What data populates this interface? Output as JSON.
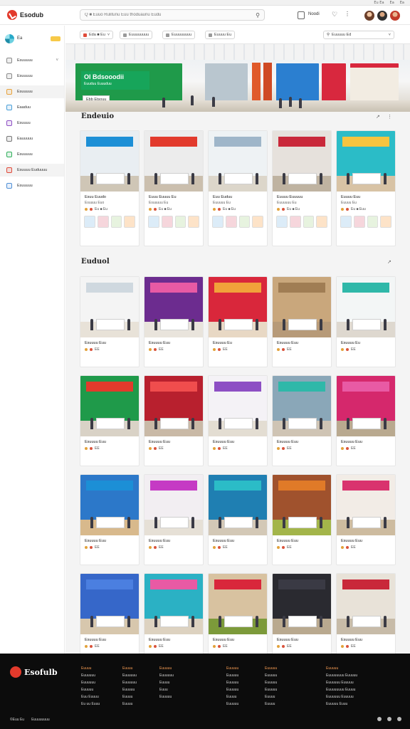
{
  "topbar": {
    "items": [
      "Eu Ea",
      "Ea",
      "Ea"
    ]
  },
  "header": {
    "brand": "Esodub",
    "search_placeholder": "Q ■ Euuo Rulitunu Euu thoduaunu Eudu",
    "notifications_label": "Noodi"
  },
  "sidebar": {
    "top_label": "Ea",
    "items": [
      {
        "label": "Esuuuuu",
        "icon": "home-icon",
        "color": "#8a8a8a",
        "has_chevron": true
      },
      {
        "label": "Esuuuuu",
        "icon": "store-icon",
        "color": "#8a8a8a"
      },
      {
        "label": "Esuuuuu",
        "icon": "grid-icon",
        "color": "#e8a23c",
        "active": true
      },
      {
        "label": "Eaaduu",
        "icon": "calendar-icon",
        "color": "#4a9fd8"
      },
      {
        "label": "Esuuuu",
        "icon": "tag-icon",
        "color": "#8d4fc4"
      },
      {
        "label": "Eauuuuu",
        "icon": "chart-icon",
        "color": "#777777"
      },
      {
        "label": "Esuuuuu",
        "icon": "leaf-icon",
        "color": "#2fae5a"
      },
      {
        "label": "Esuuuu Euduuuu",
        "icon": "alert-icon",
        "color": "#e04b3a",
        "active": true
      },
      {
        "label": "Esuuuuu",
        "icon": "settings-icon",
        "color": "#4f8fd6"
      }
    ]
  },
  "filters": [
    {
      "label": "Eda ■ Eu",
      "color": "#e04b3a"
    },
    {
      "label": "Euuuuuuuu",
      "color": "#999999"
    },
    {
      "label": "Euuuuuuuu",
      "color": "#999999"
    },
    {
      "label": "Euuuu Eu",
      "color": "#999999"
    }
  ],
  "filter_right": "Euuuuu Ed",
  "hero": {
    "sign_title": "Ol Bdsooodii",
    "sign_sub": "Euuduu Euuuduu",
    "tag": "Ebb Etsouu"
  },
  "featured": {
    "title": "Endeuio",
    "cards": [
      {
        "title": "Esuu Euudo",
        "sub": "Esuuuu Euo",
        "meta": "Eu ■ Eu",
        "wall": "#e9eef2",
        "sign": "#1c8fd6",
        "floor": "#cfc6b6"
      },
      {
        "title": "Euuu Euuuu Eu",
        "sub": "Esuuuuu Eu",
        "meta": "Eu ■ Eu",
        "wall": "#ececec",
        "sign": "#e23a2c",
        "floor": "#cbbfae"
      },
      {
        "title": "Euu Euduu",
        "sub": "Euuuuu Eu",
        "meta": "Eu ■ Eu",
        "wall": "#eef2f4",
        "sign": "#9fb6c9",
        "floor": "#dcd6ca"
      },
      {
        "title": "Euuuu Euuuuu",
        "sub": "Euuuuuu Eu",
        "meta": "Eu ■ Eu",
        "wall": "#e6e1dc",
        "sign": "#c9283a",
        "floor": "#bfb3a1"
      },
      {
        "title": "Euuuu Euu",
        "sub": "Euuuu Eu",
        "meta": "Eu ■ Euu",
        "wall": "#2bbcc7",
        "sign": "#f6c43f",
        "floor": "#d8c3a5"
      }
    ]
  },
  "more": {
    "title": "Euduol",
    "rows": [
      [
        {
          "title": "Esuuuu Euu",
          "meta": "EE",
          "wall": "#f4f4f4",
          "sign": "#cfd8df",
          "floor": "#e8e2d8"
        },
        {
          "title": "Esuuuu Euu",
          "meta": "EE",
          "wall": "#6c2c8f",
          "sign": "#e85aa4",
          "floor": "#e9e4dc"
        },
        {
          "title": "Esuuuu Eu",
          "meta": "EE",
          "wall": "#d9273b",
          "sign": "#f1a23a",
          "floor": "#e8d8c4"
        },
        {
          "title": "Esuuuu Euu",
          "meta": "EE",
          "wall": "#c9a77c",
          "sign": "#a07d54",
          "floor": "#b79a78"
        },
        {
          "title": "Esuuuu Eu",
          "meta": "EE",
          "wall": "#f3f6f6",
          "sign": "#2fb8a9",
          "floor": "#ded8cf"
        }
      ],
      [
        {
          "title": "Esuuuu Euu",
          "meta": "EE",
          "wall": "#1f9a4a",
          "sign": "#e23a2c",
          "floor": "#d9d2c6"
        },
        {
          "title": "Esuuuu Euu",
          "meta": "EE",
          "wall": "#b8202e",
          "sign": "#f04d4d",
          "floor": "#c9b9a6"
        },
        {
          "title": "Esuuuu Euu",
          "meta": "EE",
          "wall": "#f4f2f6",
          "sign": "#8d4fc4",
          "floor": "#e3ddd2"
        },
        {
          "title": "Esuuuu Euu",
          "meta": "EE",
          "wall": "#8aa7b8",
          "sign": "#2fb8a9",
          "floor": "#cfc4b4"
        },
        {
          "title": "Esuuuu Euu",
          "meta": "EE",
          "wall": "#d5286c",
          "sign": "#e85aa4",
          "floor": "#b9a98f"
        }
      ],
      [
        {
          "title": "Esuuuu Euu",
          "meta": "EE",
          "wall": "#2c78c9",
          "sign": "#1c8fd6",
          "floor": "#d8b98c"
        },
        {
          "title": "Esuuuu Euu",
          "meta": "EE",
          "wall": "#f2eef2",
          "sign": "#c53ac4",
          "floor": "#e6e0d6"
        },
        {
          "title": "Esuuuu Euu",
          "meta": "EE",
          "wall": "#1f7fb2",
          "sign": "#2bbcc7",
          "floor": "#d3c8b6"
        },
        {
          "title": "Esuuuu Euu",
          "meta": "EE",
          "wall": "#a0522d",
          "sign": "#e07a28",
          "floor": "#a3b54a"
        },
        {
          "title": "Esuuuu Euu",
          "meta": "EE",
          "wall": "#f2ece6",
          "sign": "#d9336e",
          "floor": "#cdbb9f"
        }
      ],
      [
        {
          "title": "Esuuuu Euu",
          "meta": "EE",
          "wall": "#3667c9",
          "sign": "#4b7fe0",
          "floor": "#d7c7ad"
        },
        {
          "title": "Esuuuu Euu",
          "meta": "EE",
          "wall": "#2bb1c4",
          "sign": "#e85aa4",
          "floor": "#ddd2c0"
        },
        {
          "title": "Esuuuu Euu",
          "meta": "EE",
          "wall": "#d8c2a0",
          "sign": "#d9273b",
          "floor": "#7c9a3a"
        },
        {
          "title": "Esuuuu Euu",
          "meta": "EE",
          "wall": "#2a2a30",
          "sign": "#3a3a44",
          "floor": "#b9a98f"
        },
        {
          "title": "Esuuuu Euu",
          "meta": "EE",
          "wall": "#e8e2d8",
          "sign": "#c9283a",
          "floor": "#c7bba8"
        }
      ]
    ]
  },
  "footer": {
    "brand": "Esofulb",
    "columns": [
      [
        "Euuuu",
        "Euuuuuu",
        "Euuuuuu",
        "Euuuuu",
        "Euu Euuuu",
        "Eu uu Euuu"
      ],
      [
        "Euuuu",
        "Euuuuuu",
        "Euuuuuu",
        "Euuuuu",
        "Euuuu",
        "Euuuu"
      ],
      [
        "Euuuuu",
        "Euuuuuu",
        "Euuuu",
        "",
        "Euuu",
        "Euuuuu"
      ],
      [
        "Euuuuu",
        "Euuuuu",
        "Euuuuu",
        "Euuuuu",
        "Euuuu",
        "Euuuuu"
      ],
      [
        "Euuuuu",
        "Euuuuu",
        "Euuuuu",
        "Euuuuu",
        "Euuuu",
        "Euuuu"
      ],
      [
        "Euuuuu",
        "Euuuuuuuu Euuuuu",
        "Euuuuuu Euuuuu",
        "Euuuuuuuu Euuuu",
        "Euuuuuu Euuuuu",
        "Euuuuu Euuu"
      ]
    ],
    "bottom": [
      "©Euu Eu",
      "Euuuuuuuu"
    ]
  }
}
